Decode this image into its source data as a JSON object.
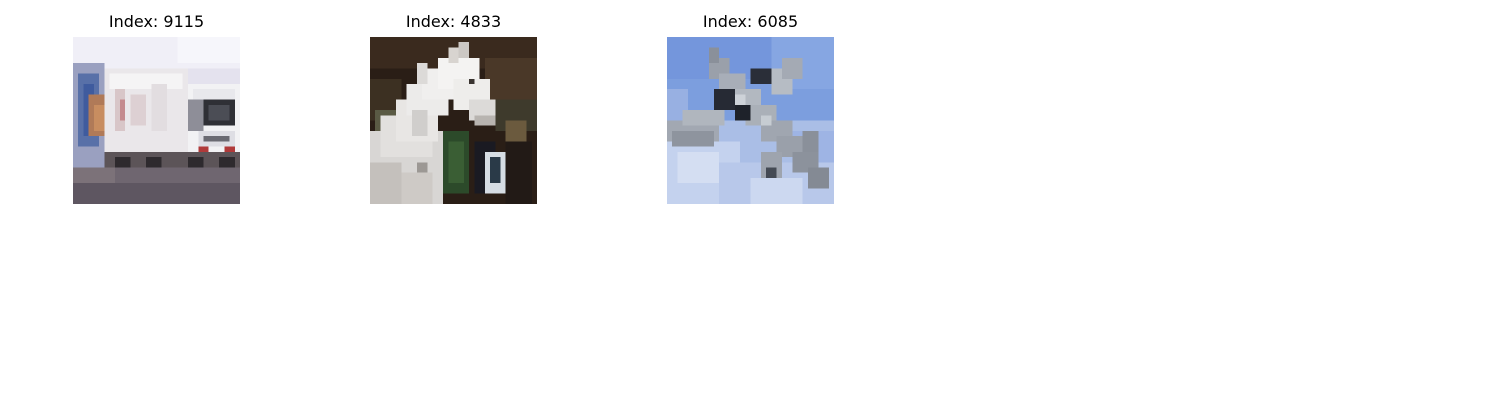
{
  "panels": [
    {
      "title": "Index: 9115",
      "subject": "truck"
    },
    {
      "title": "Index: 4833",
      "subject": "horse"
    },
    {
      "title": "Index: 6085",
      "subject": "airplane"
    }
  ]
}
